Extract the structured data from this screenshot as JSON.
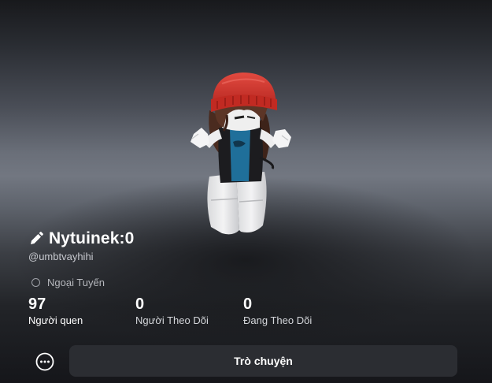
{
  "profile": {
    "display_name": "Nytuinek:0",
    "username": "@umbtvayhihi",
    "status": "Ngoại Tuyến"
  },
  "stats": [
    {
      "value": "97",
      "label": "Người quen"
    },
    {
      "value": "0",
      "label": "Người Theo Dõi"
    },
    {
      "value": "0",
      "label": "Đang Theo Dõi"
    }
  ],
  "actions": {
    "chat_label": "Trò chuyện"
  },
  "icons": {
    "edit": "pencil-icon",
    "status": "offline-status-icon",
    "more": "more-options-icon"
  }
}
